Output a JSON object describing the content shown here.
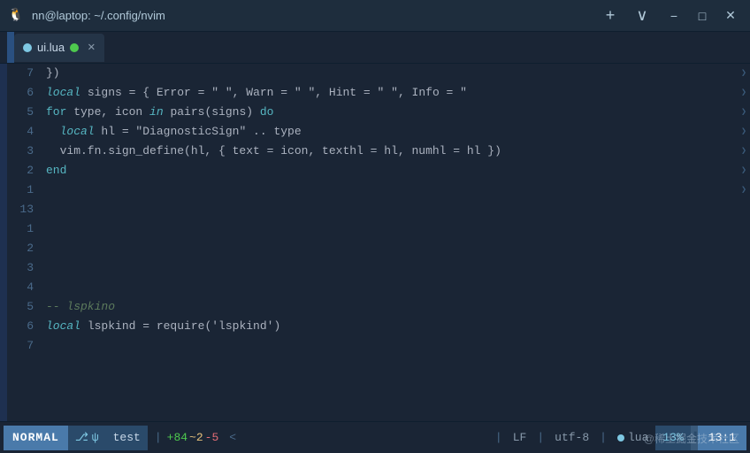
{
  "titlebar": {
    "title": "nn@laptop: ~/.config/nvim",
    "icon": "🐧",
    "new_tab": "+",
    "chevron": "∨",
    "minimize": "−",
    "maximize": "□",
    "close": "✕"
  },
  "tab": {
    "name": "ui.lua",
    "close": "✕"
  },
  "editor": {
    "lines": [
      {
        "num": "7",
        "tokens": [
          {
            "t": "plain",
            "v": "})"
          }
        ],
        "indicator": "❯"
      },
      {
        "num": "6",
        "tokens": [
          {
            "t": "kw-local",
            "v": "local"
          },
          {
            "t": "plain",
            "v": " signs = { Error = \""
          },
          {
            "t": "error-icon",
            "v": " "
          },
          {
            "t": "plain",
            "v": "\", Warn = \""
          },
          {
            "t": "warn-icon",
            "v": " "
          },
          {
            "t": "plain",
            "v": "\", Hint = \""
          },
          {
            "t": "hint-icon",
            "v": " "
          },
          {
            "t": "plain",
            "v": "\", Info = \""
          },
          {
            "t": "info-text",
            "v": " "
          }
        ],
        "indicator": "❯"
      },
      {
        "num": "5",
        "tokens": [
          {
            "t": "kw-for",
            "v": "for"
          },
          {
            "t": "plain",
            "v": " type, icon "
          },
          {
            "t": "kw-in",
            "v": "in"
          },
          {
            "t": "plain",
            "v": " pairs(signs) "
          },
          {
            "t": "kw-do",
            "v": "do"
          }
        ],
        "indicator": "❯"
      },
      {
        "num": "4",
        "tokens": [
          {
            "t": "plain",
            "v": "  "
          },
          {
            "t": "kw-local",
            "v": "local"
          },
          {
            "t": "plain",
            "v": " hl = \"DiagnosticSign\" .. type"
          }
        ],
        "indicator": "❯"
      },
      {
        "num": "3",
        "tokens": [
          {
            "t": "plain",
            "v": "  vim.fn.sign_define(hl, { text = icon, texthl = hl, numhl = hl })"
          }
        ],
        "indicator": "❯"
      },
      {
        "num": "2",
        "tokens": [
          {
            "t": "kw-end",
            "v": "end"
          }
        ],
        "indicator": "❯"
      },
      {
        "num": "1",
        "tokens": [],
        "indicator": "❯"
      },
      {
        "num": "13",
        "tokens": [],
        "indicator": ""
      },
      {
        "num": "1",
        "tokens": [],
        "indicator": ""
      },
      {
        "num": "2",
        "tokens": [],
        "indicator": ""
      },
      {
        "num": "3",
        "tokens": [],
        "indicator": ""
      },
      {
        "num": "4",
        "tokens": [],
        "indicator": ""
      },
      {
        "num": "5",
        "tokens": [
          {
            "t": "comment",
            "v": "-- lspkino"
          }
        ],
        "indicator": ""
      },
      {
        "num": "6",
        "tokens": [
          {
            "t": "kw-local",
            "v": "local"
          },
          {
            "t": "plain",
            "v": " lspkind = require('lspkind')"
          }
        ],
        "indicator": ""
      },
      {
        "num": "7",
        "tokens": [],
        "indicator": ""
      }
    ]
  },
  "statusbar": {
    "mode": "NORMAL",
    "git_branch_icon": "⎇",
    "git_icon": "ψ",
    "filename": "test",
    "diff_add": "+84",
    "diff_mod": "~2",
    "diff_del": "-5",
    "sep": "<",
    "lf": "LF",
    "encoding": "utf-8",
    "ft": "lua",
    "percent": "13%",
    "position": "13:1"
  },
  "watermark": "@稀土掘金技术社区"
}
